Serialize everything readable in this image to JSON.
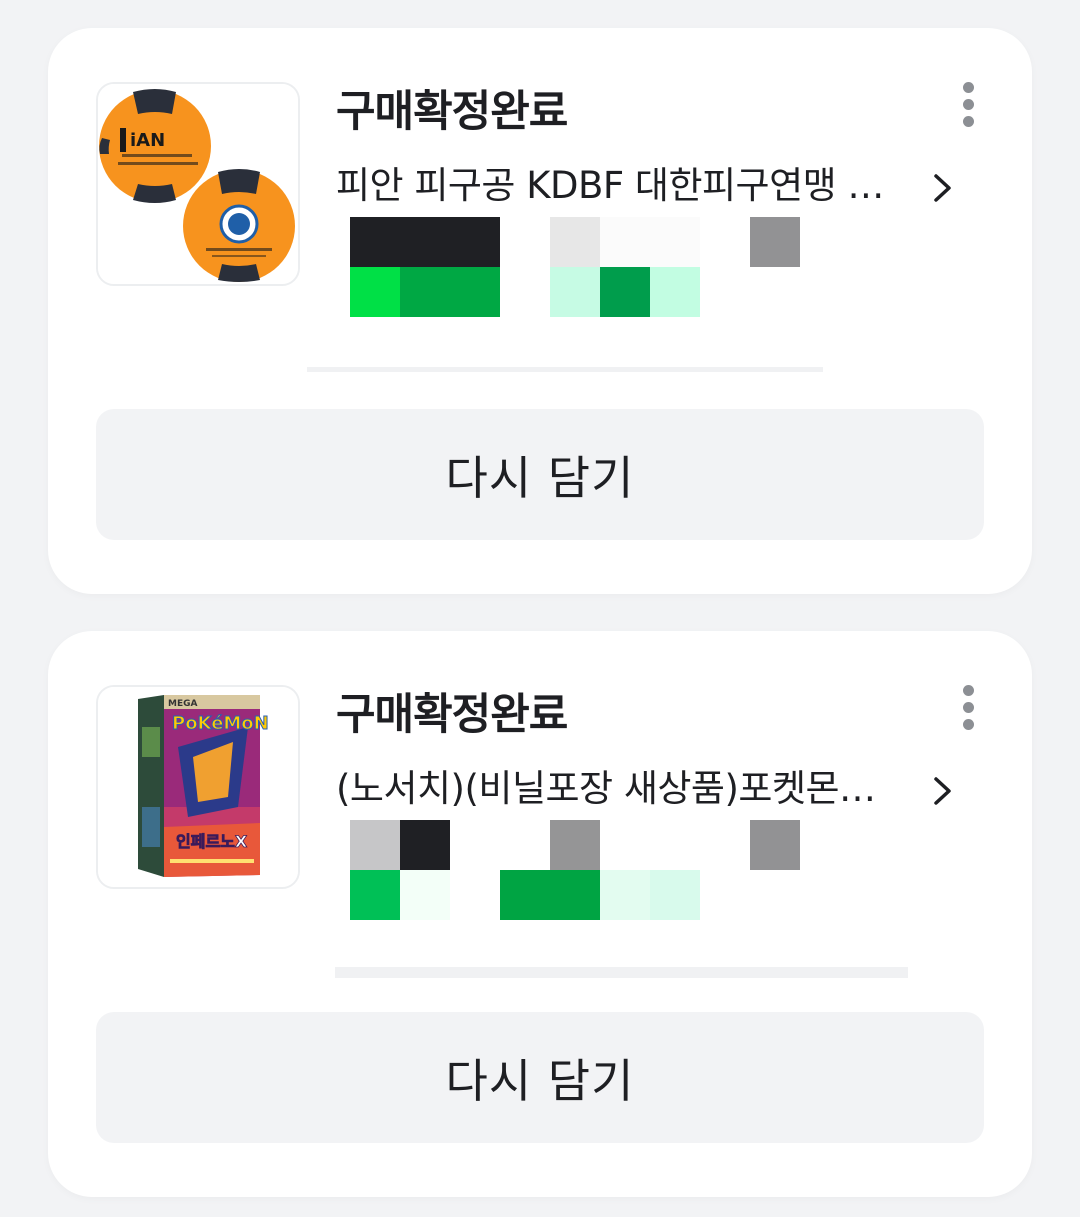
{
  "orders": [
    {
      "status": "구매확정완료",
      "title": "피안 피구공 KDBF 대한피구연맹 공식사용구",
      "rebuy_label": "다시 담기",
      "thumbnail": "orange-dodgeball-image",
      "logo_text": "PiAN"
    },
    {
      "status": "구매확정완료",
      "title": "(노서치)(비닐포장 새상품)포켓몬 카드",
      "rebuy_label": "다시 담기",
      "thumbnail": "pokemon-card-box-image",
      "logo_text": "Pokémon"
    }
  ],
  "colors": {
    "background": "#f2f3f5",
    "card": "#ffffff",
    "text": "#1e1f23",
    "button": "#f2f3f5",
    "icon": "#8c8f94"
  }
}
